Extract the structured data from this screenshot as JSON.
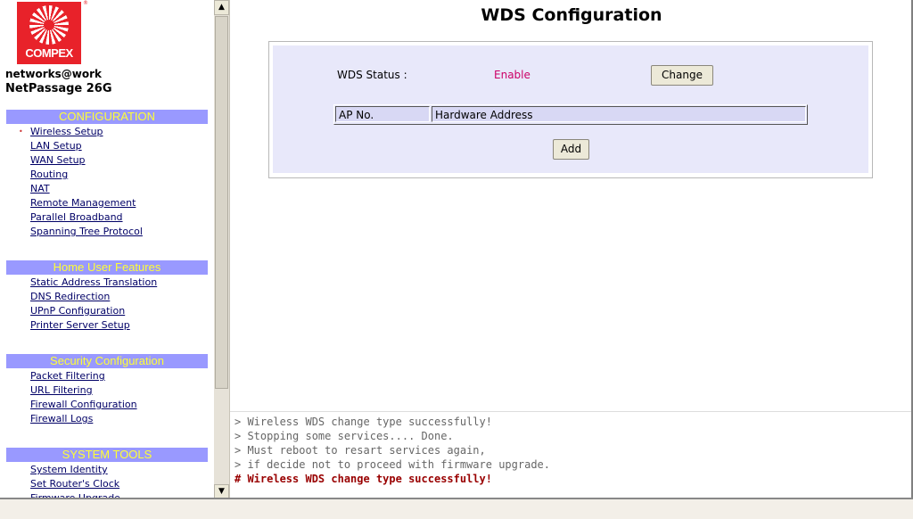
{
  "brand": {
    "logo_text": "COMPEX",
    "reg_mark": "®",
    "tagline": "networks@work",
    "model": "NetPassage 26G"
  },
  "nav": {
    "sections": [
      {
        "title": "CONFIGURATION",
        "items": [
          "Wireless Setup",
          "LAN Setup",
          "WAN Setup",
          "Routing",
          "NAT",
          "Remote Management",
          "Parallel Broadband",
          "Spanning Tree Protocol"
        ]
      },
      {
        "title": "Home User Features",
        "items": [
          "Static Address Translation",
          "DNS Redirection",
          "UPnP Configuration",
          "Printer Server Setup"
        ]
      },
      {
        "title": "Security Configuration",
        "items": [
          "Packet Filtering",
          "URL Filtering",
          "Firewall Configuration",
          "Firewall Logs"
        ]
      },
      {
        "title": "SYSTEM TOOLS",
        "items": [
          "System Identity",
          "Set Router's Clock",
          "Firmware Upgrade"
        ]
      }
    ],
    "active_marker": "•"
  },
  "scrollbar": {
    "up": "▲",
    "down": "▼"
  },
  "main": {
    "title": "WDS Configuration",
    "status_label": "WDS Status :",
    "status_value": "Enable",
    "change_button": "Change",
    "table_headers": [
      "AP No.",
      "Hardware Address"
    ],
    "add_button": "Add"
  },
  "log": {
    "lines": [
      "> Wireless WDS change type successfully!",
      "> Stopping some services.... Done.",
      "> Must reboot to resart services again,",
      "> if decide not to proceed with firmware upgrade."
    ],
    "final_line": "# Wireless WDS change type successfully!"
  },
  "colors": {
    "section_bg": "#9999ff",
    "section_text": "#ffff33",
    "status_value": "#cc0066",
    "log_final": "#990000",
    "brand_red": "#e8222a"
  }
}
